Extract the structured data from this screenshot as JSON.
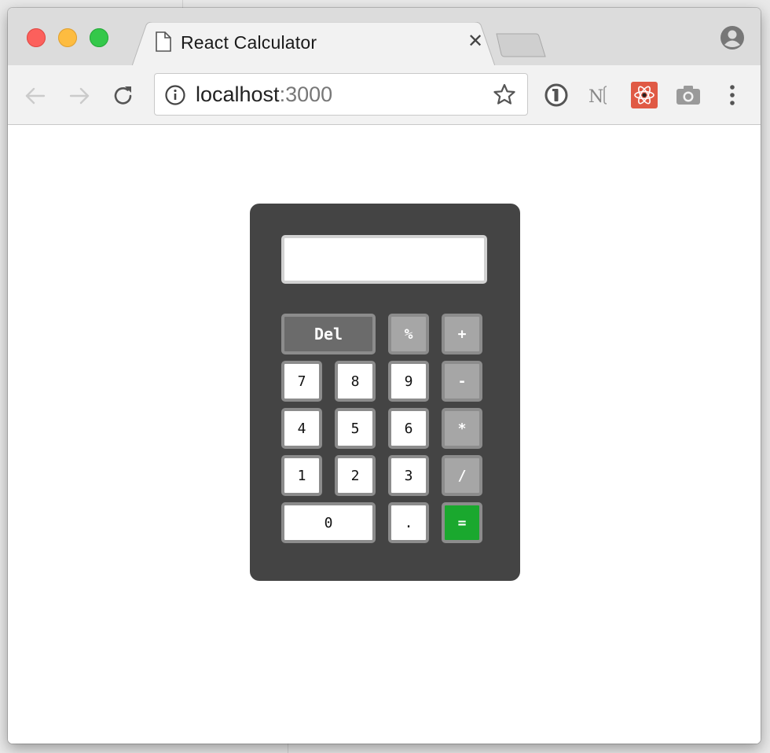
{
  "browser": {
    "tab_title": "React Calculator",
    "tab_close": "✕",
    "url_host": "localhost",
    "url_port": ":3000"
  },
  "calculator": {
    "display_value": "",
    "keys": {
      "del": "Del",
      "percent": "%",
      "plus": "+",
      "seven": "7",
      "eight": "8",
      "nine": "9",
      "minus": "-",
      "four": "4",
      "five": "5",
      "six": "6",
      "multiply": "*",
      "one": "1",
      "two": "2",
      "three": "3",
      "divide": "/",
      "zero": "0",
      "dot": ".",
      "equals": "="
    },
    "colors": {
      "body": "#444444",
      "number_key": "#ffffff",
      "operator_key": "#a6a6a6",
      "delete_key": "#6b6b6b",
      "equals_key": "#1aa82e"
    }
  },
  "icons": {
    "page": "page-icon",
    "close": "close-icon",
    "profile": "profile-icon",
    "back": "back-arrow-icon",
    "forward": "forward-arrow-icon",
    "reload": "reload-icon",
    "info": "info-icon",
    "star": "star-icon",
    "password_manager": "1password-icon",
    "notion_extension": "notion-icon",
    "react_devtools": "react-devtools-icon",
    "screenshot": "camera-icon",
    "menu": "kebab-menu-icon"
  }
}
